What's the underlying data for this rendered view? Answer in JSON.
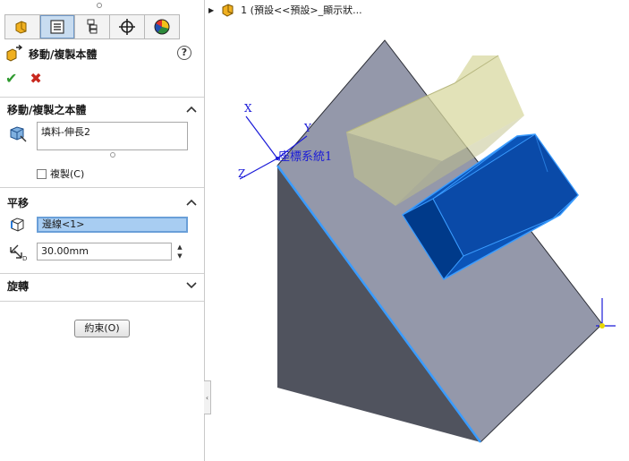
{
  "property_manager": {
    "tabs": [
      {
        "name": "featuremanager",
        "icon": "feature-tree-icon"
      },
      {
        "name": "propertymanager",
        "icon": "property-manager-icon"
      },
      {
        "name": "configurationmanager",
        "icon": "configuration-icon"
      },
      {
        "name": "dimxpert",
        "icon": "crosshair-icon"
      },
      {
        "name": "display",
        "icon": "appearance-icon"
      }
    ],
    "title": "移動/複製本體",
    "help_glyph": "?",
    "ok_glyph": "✔",
    "cancel_glyph": "✖",
    "bodies_section": {
      "heading": "移動/複製之本體",
      "bodies": [
        "填料-伸長2"
      ],
      "copy_label": "複製(C)",
      "copy_checked": false
    },
    "translate_section": {
      "heading": "平移",
      "reference": "邊線<1>",
      "distance": "30.00mm"
    },
    "rotate_section": {
      "heading": "旋轉"
    },
    "constraints_button": "約束(O)"
  },
  "viewport": {
    "tree_item": "1 (預設<<預設>_顯示狀...",
    "coordinate_system_label": "座標系統1",
    "axis_labels": {
      "x": "X",
      "y": "Y",
      "z": "Z"
    },
    "colors": {
      "wedge_face": "#9498aa",
      "wedge_side": "#50535e",
      "selected_edge": "#3a9cff",
      "selected_body": "#0b54b8",
      "preview_body": "#d8d8a0",
      "axis": "#1a1ad8"
    }
  }
}
